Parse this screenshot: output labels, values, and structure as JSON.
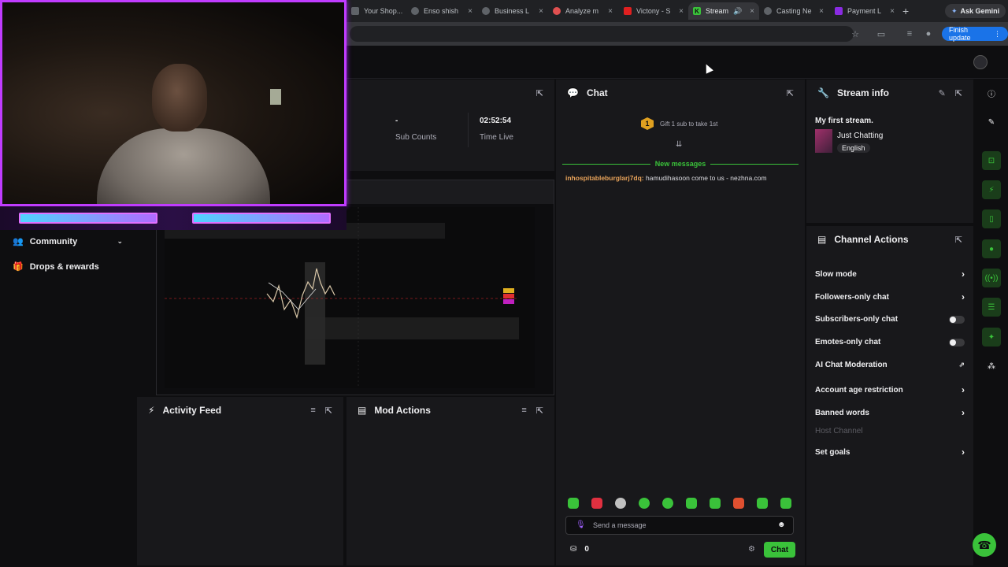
{
  "browser": {
    "tabs": [
      {
        "label": "Your Shop...",
        "color": "#5f6368"
      },
      {
        "label": "Enso shish",
        "color": "#5f6368"
      },
      {
        "label": "Business L",
        "color": "#5f6368"
      },
      {
        "label": "Analyze m",
        "color": "#e05050"
      },
      {
        "label": "Victony - S",
        "color": "#e02020"
      },
      {
        "label": "Stream",
        "color": "#3ac23a"
      },
      {
        "label": "Casting Ne",
        "color": "#5f6368"
      },
      {
        "label": "Payment L",
        "color": "#8a2be2"
      }
    ],
    "gemini_label": "Ask Gemini",
    "finish_label": "Finish update"
  },
  "nav": {
    "community": "Community",
    "drops": "Drops & rewards"
  },
  "stats": {
    "sub_value": "-",
    "sub_label": "Sub Counts",
    "time_value": "02:52:54",
    "time_label": "Time Live"
  },
  "chat": {
    "title": "Chat",
    "gift_badge": "1",
    "gift_text": "Gift 1 sub to take 1st",
    "new_messages": "New messages",
    "messages": [
      {
        "user": "inhospitableburglarj7dq:",
        "text": "hamudihasoon come to us - nezhna.com"
      }
    ],
    "placeholder": "Send a message",
    "points": "0",
    "send_label": "Chat"
  },
  "stream_info": {
    "title": "Stream info",
    "stream_title": "My first stream.",
    "category": "Just Chatting",
    "language": "English"
  },
  "channel_actions": {
    "title": "Channel Actions",
    "rows": [
      {
        "label": "Slow mode",
        "control": "chevron"
      },
      {
        "label": "Followers-only chat",
        "control": "chevron"
      },
      {
        "label": "Subscribers-only chat",
        "control": "toggle"
      },
      {
        "label": "Emotes-only chat",
        "control": "toggle"
      },
      {
        "label": "AI Chat Moderation",
        "control": "external"
      },
      {
        "label": "Account age restriction",
        "control": "chevron"
      },
      {
        "label": "Banned words",
        "control": "chevron"
      },
      {
        "label": "Host Channel",
        "control": "disabled"
      },
      {
        "label": "Set goals",
        "control": "chevron"
      }
    ]
  },
  "activity": {
    "title": "Activity Feed"
  },
  "modactions": {
    "title": "Mod Actions"
  },
  "colors": {
    "accent": "#3ac23a",
    "neon": "#c03cff",
    "username": "#e8a35a",
    "new_messages": "#3ac23a"
  }
}
